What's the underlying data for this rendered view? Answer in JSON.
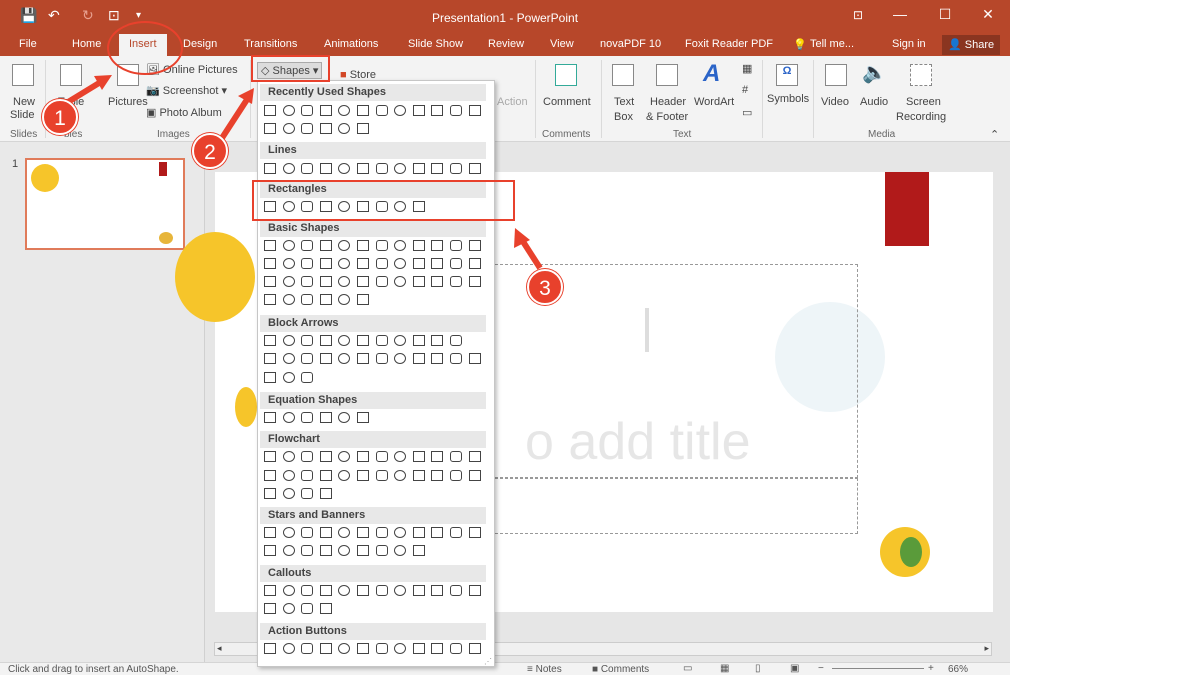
{
  "window": {
    "title": "Presentation1 - PowerPoint"
  },
  "tabs": [
    "File",
    "Home",
    "Insert",
    "Design",
    "Transitions",
    "Animations",
    "Slide Show",
    "Review",
    "View",
    "novaPDF 10",
    "Foxit Reader PDF",
    "Tell me...",
    "Sign in",
    "Share"
  ],
  "ribbon": {
    "new_slide": [
      "New",
      "Slide"
    ],
    "table": "Table",
    "pictures": "Pictures",
    "online_pictures": "Online Pictures",
    "screenshot": "Screenshot",
    "photo_album": "Photo Album",
    "shapes": "Shapes",
    "store": "Store",
    "action": "Action",
    "comment": "Comment",
    "text_box": [
      "Text",
      "Box"
    ],
    "header_footer": [
      "Header",
      "& Footer"
    ],
    "wordart": "WordArt",
    "symbols": "Symbols",
    "video": "Video",
    "audio": "Audio",
    "screen_recording": [
      "Screen",
      "Recording"
    ],
    "groups": [
      "Slides",
      "Images",
      "Comments",
      "Text",
      "Media"
    ],
    "groups_partial": [
      "bles"
    ]
  },
  "thumb": {
    "number": "1"
  },
  "slide": {
    "title_placeholder": "o add title"
  },
  "shapes_menu": {
    "sections": [
      "Recently Used Shapes",
      "Lines",
      "Rectangles",
      "Basic Shapes",
      "Block Arrows",
      "Equation Shapes",
      "Flowchart",
      "Stars and Banners",
      "Callouts",
      "Action Buttons"
    ]
  },
  "statusbar": {
    "hint": "Click and drag to insert an AutoShape.",
    "notes": "Notes",
    "comments": "Comments",
    "zoom": "66%"
  },
  "steps": [
    "1",
    "2",
    "3"
  ],
  "colors": {
    "accent": "#b7472a",
    "annotation": "#e8412c",
    "slide_red": "#b11a1a"
  }
}
